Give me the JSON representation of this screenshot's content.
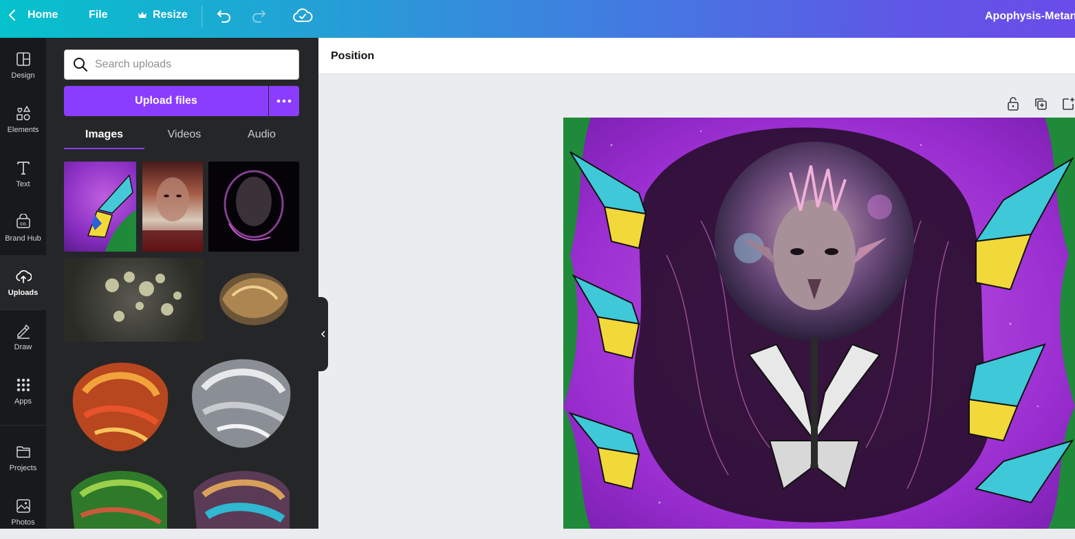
{
  "topbar": {
    "home_label": "Home",
    "file_label": "File",
    "resize_label": "Resize",
    "design_title": "Apophysis-Metan"
  },
  "rail": {
    "items": [
      {
        "label": "Design",
        "icon": "layout-icon"
      },
      {
        "label": "Elements",
        "icon": "shapes-icon"
      },
      {
        "label": "Text",
        "icon": "text-icon"
      },
      {
        "label": "Brand Hub",
        "icon": "brand-hub-icon"
      },
      {
        "label": "Uploads",
        "icon": "cloud-upload-icon",
        "active": true
      },
      {
        "label": "Draw",
        "icon": "pen-icon"
      },
      {
        "label": "Apps",
        "icon": "grid-icon"
      },
      {
        "label": "Projects",
        "icon": "folder-icon"
      },
      {
        "label": "Photos",
        "icon": "image-icon"
      }
    ]
  },
  "panel": {
    "search_placeholder": "Search uploads",
    "upload_button": "Upload files",
    "tabs": [
      {
        "label": "Images",
        "active": true
      },
      {
        "label": "Videos"
      },
      {
        "label": "Audio"
      }
    ]
  },
  "context_bar": {
    "position_label": "Position"
  },
  "colors": {
    "accent": "#8b3dff",
    "rail_bg": "#18191b",
    "panel_bg": "#252627",
    "canvas_bg": "#ebecf0"
  }
}
